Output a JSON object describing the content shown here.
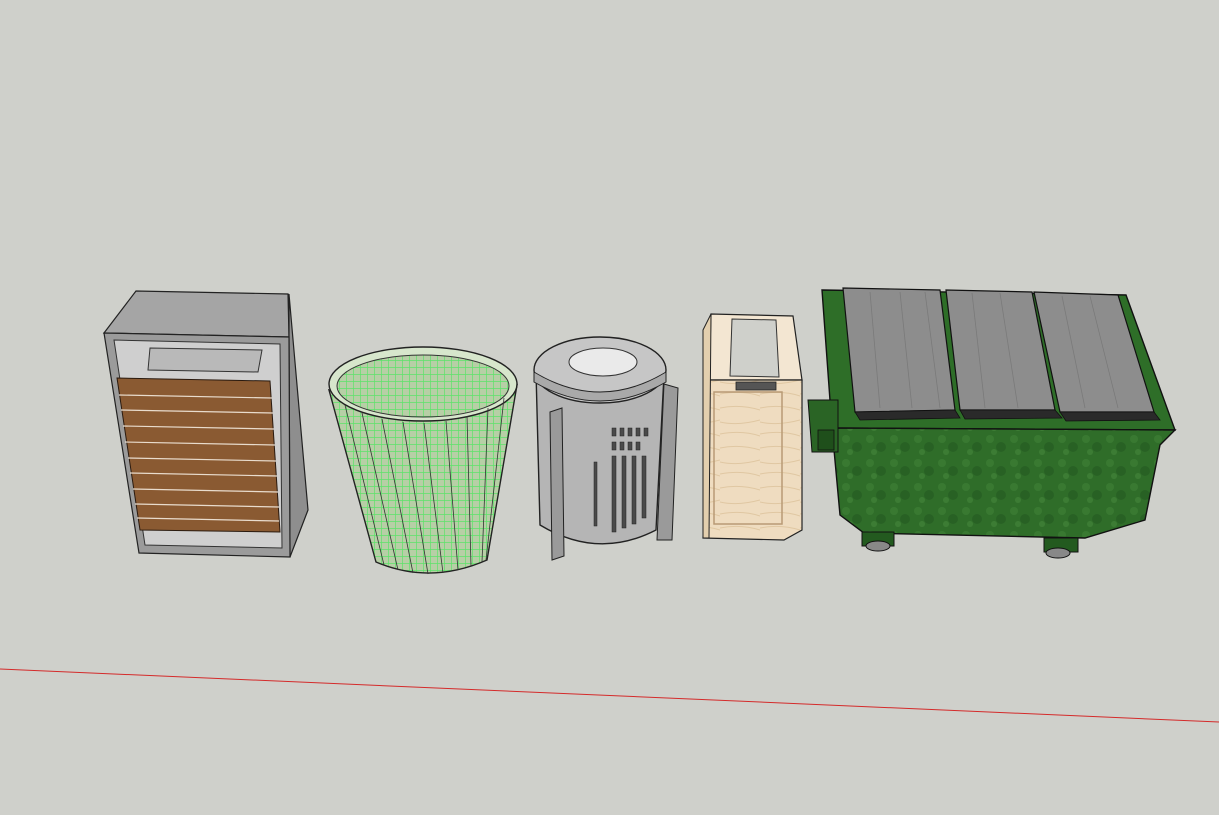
{
  "scene": {
    "background": "#cfd0cb",
    "axis_color": "#d42a2a",
    "objects": [
      {
        "id": "slatted-bin",
        "kind": "slatted-litter-bin",
        "colors": {
          "frame": "#8e8e8e",
          "slat": "#8a5a32"
        }
      },
      {
        "id": "mesh-bin",
        "kind": "tapered-mesh-wastebasket",
        "colors": {
          "body": "#b7cfa6",
          "grid": "#5de36a"
        }
      },
      {
        "id": "metal-bin",
        "kind": "round-perforated-metal-bin",
        "colors": {
          "body": "#b5b5b5"
        }
      },
      {
        "id": "wood-bin",
        "kind": "wooden-box-bin",
        "colors": {
          "body": "#efdcc0"
        }
      },
      {
        "id": "dumpster",
        "kind": "wheeled-dumpster",
        "colors": {
          "body": "#2c6b27",
          "lid": "#8d8d8d"
        }
      }
    ]
  }
}
